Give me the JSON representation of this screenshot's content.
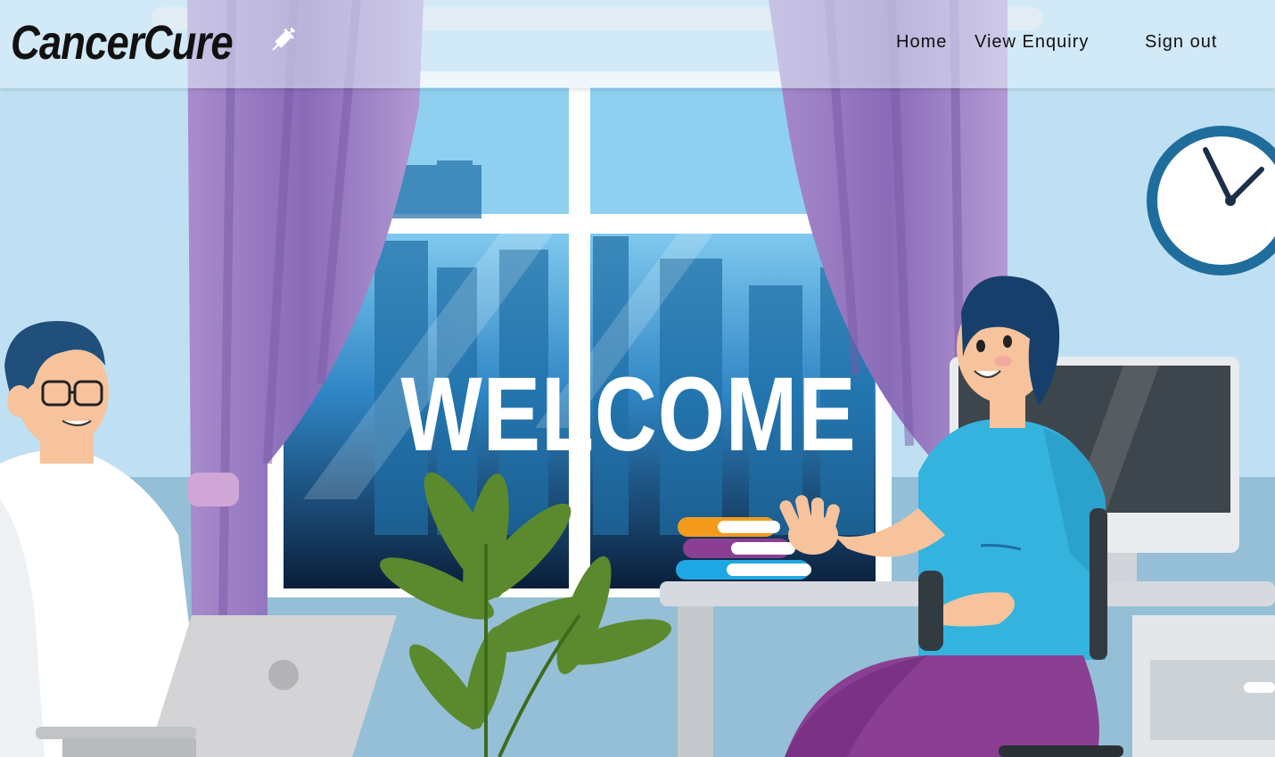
{
  "brand": {
    "name": "CancerCure",
    "icon": "syringe-icon"
  },
  "nav": {
    "home": "Home",
    "view_enquiry": "View Enquiry",
    "sign_out": "Sign out"
  },
  "hero": {
    "heading": "WELCOME"
  },
  "colors": {
    "sky": "#bfe0f3",
    "curtain": "#9b7cc4",
    "window_dark": "#0f2a4a",
    "shirt_blue": "#35b3df",
    "pants_purple": "#8a3f93",
    "plant": "#5b8a2e"
  }
}
